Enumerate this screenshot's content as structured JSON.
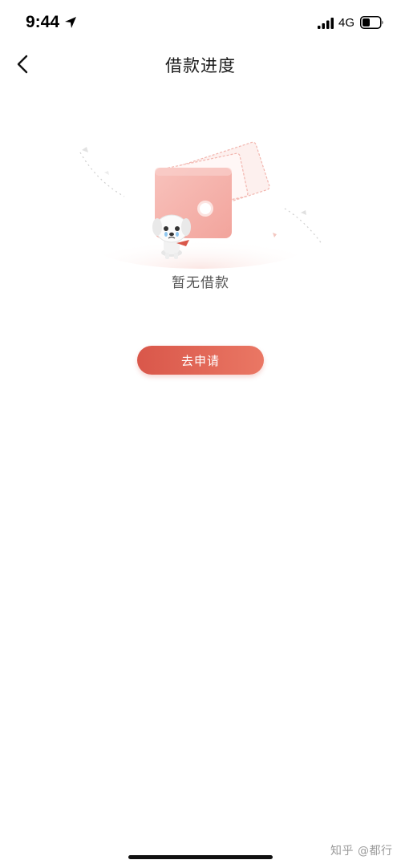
{
  "status_bar": {
    "time": "9:44",
    "network": "4G"
  },
  "nav": {
    "title": "借款进度"
  },
  "empty_state": {
    "message": "暂无借款"
  },
  "actions": {
    "apply_label": "去申请"
  },
  "watermark": {
    "text": "知乎 @都行"
  },
  "colors": {
    "accent_start": "#d9574a",
    "accent_end": "#ea7764",
    "wallet": "#f6b3ad"
  },
  "icons": {
    "back": "chevron-left-icon",
    "location": "location-arrow-icon",
    "signal": "signal-icon",
    "battery": "battery-icon"
  }
}
